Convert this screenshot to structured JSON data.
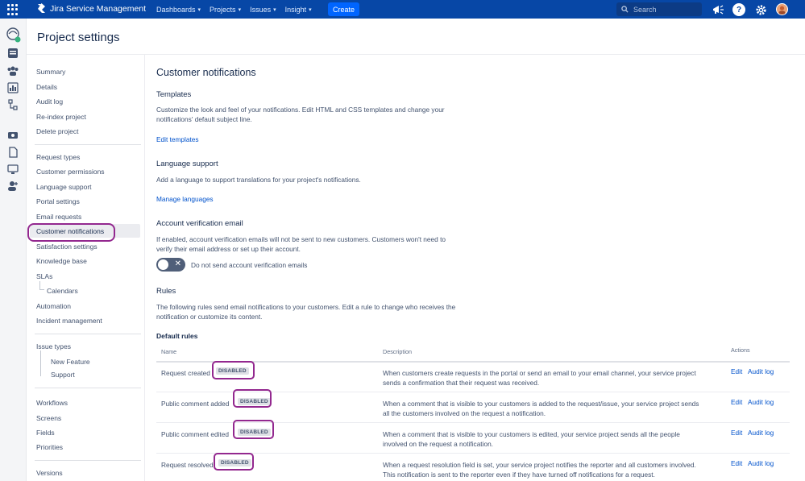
{
  "topnav": {
    "app_name": "Jira Service Management",
    "menus": [
      "Dashboards",
      "Projects",
      "Issues",
      "Insight"
    ],
    "create_label": "Create",
    "search_placeholder": "Search"
  },
  "page_title": "Project settings",
  "sidebar": {
    "group1": [
      "Summary",
      "Details",
      "Audit log",
      "Re-index project",
      "Delete project"
    ],
    "group2": [
      "Request types",
      "Customer permissions",
      "Language support",
      "Portal settings",
      "Email requests",
      "Customer notifications",
      "Satisfaction settings",
      "Knowledge base",
      "SLAs",
      "Calendars",
      "Automation",
      "Incident management"
    ],
    "group3": [
      "Issue types",
      "New Feature",
      "Support"
    ],
    "group4": [
      "Workflows",
      "Screens",
      "Fields",
      "Priorities"
    ],
    "group5": [
      "Versions"
    ],
    "active": "Customer notifications"
  },
  "main": {
    "title": "Customer notifications",
    "templates": {
      "heading": "Templates",
      "text": "Customize the look and feel of your notifications. Edit HTML and CSS templates and change your notifications' default subject line.",
      "link": "Edit templates"
    },
    "language": {
      "heading": "Language support",
      "text": "Add a language to support translations for your project's notifications.",
      "link": "Manage languages"
    },
    "verification": {
      "heading": "Account verification email",
      "text": "If enabled, account verification emails will not be sent to new customers. Customers won't need to verify their email address or set up their account.",
      "toggle_label": "Do not send account verification emails",
      "toggle_on": false
    },
    "rules": {
      "heading": "Rules",
      "text": "The following rules send email notifications to your customers. Edit a rule to change who receives the notification or customize its content.",
      "default_heading": "Default rules",
      "columns": [
        "Name",
        "Description",
        "Actions"
      ],
      "rows": [
        {
          "name": "Request created",
          "status": "DISABLED",
          "description": "When customers create requests in the portal or send an email to your email channel, your service project sends a confirmation that their request was received.",
          "edit": "Edit",
          "audit": "Audit log"
        },
        {
          "name": "Public comment added",
          "status": "DISABLED",
          "description": "When a comment that is visible to your customers is added to the request/issue, your service project sends all the customers involved on the request a notification.",
          "edit": "Edit",
          "audit": "Audit log"
        },
        {
          "name": "Public comment edited",
          "status": "DISABLED",
          "description": "When a comment that is visible to your customers is edited, your service project sends all the people involved on the request a notification.",
          "edit": "Edit",
          "audit": "Audit log"
        },
        {
          "name": "Request resolved",
          "status": "DISABLED",
          "description": "When a request resolution field is set, your service project notifies the reporter and all customers involved. This notification is sent to the reporter even if they have turned off notifications for a request.",
          "edit": "Edit",
          "audit": "Audit log"
        }
      ]
    }
  },
  "colors": {
    "nav": "#0747a6",
    "create": "#0065ff",
    "link": "#0052cc",
    "highlight": "#93288f"
  }
}
